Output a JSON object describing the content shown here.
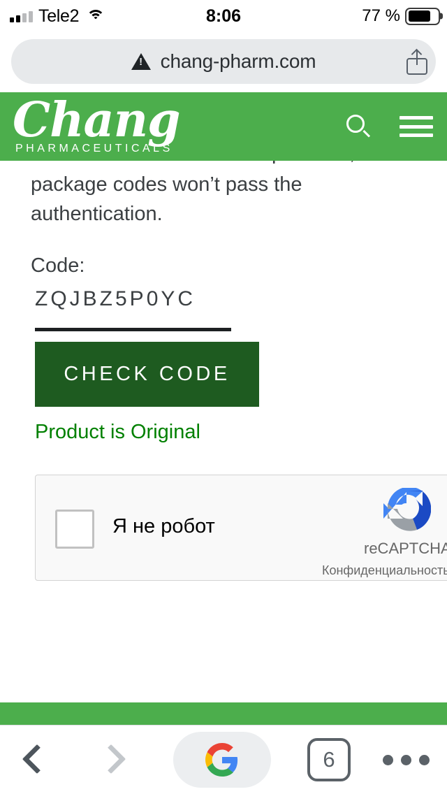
{
  "status_bar": {
    "carrier": "Tele2",
    "time": "8:06",
    "battery_percent": "77 %",
    "signal_icon": "signal-bars-icon",
    "wifi_icon": "wifi-icon",
    "battery_icon": "battery-icon"
  },
  "browser": {
    "url": "chang-pharm.com",
    "security_icon": "warning-triangle-icon",
    "share_icon": "share-icon",
    "back_icon": "chevron-left-icon",
    "forward_icon": "chevron-right-icon",
    "google_icon": "google-g-icon",
    "tab_count": "6",
    "more_icon": "more-dots-icon"
  },
  "site_header": {
    "logo_main": "Chang",
    "logo_sub": "PHARMACEUTICALS",
    "search_icon": "search-icon",
    "menu_icon": "hamburger-menu-icon",
    "bg_color": "#4cae4c"
  },
  "page": {
    "paragraph_clipped": "recommend not to use the products, which",
    "paragraph_line2": "package codes won’t pass the",
    "paragraph_line3": "authentication.",
    "code_label": "Code:",
    "code_value": "ZQJBZ5P0YC",
    "check_button": "CHECK CODE",
    "result_message": "Product is Original",
    "result_color": "#008000",
    "button_color": "#1e5b20"
  },
  "recaptcha": {
    "label": "Я не робот",
    "brand": "reCAPTCHA",
    "terms": "Конфиденциальность - Условия использования",
    "checkbox_icon": "checkbox-unchecked-icon",
    "logo_icon": "recaptcha-logo-icon"
  }
}
